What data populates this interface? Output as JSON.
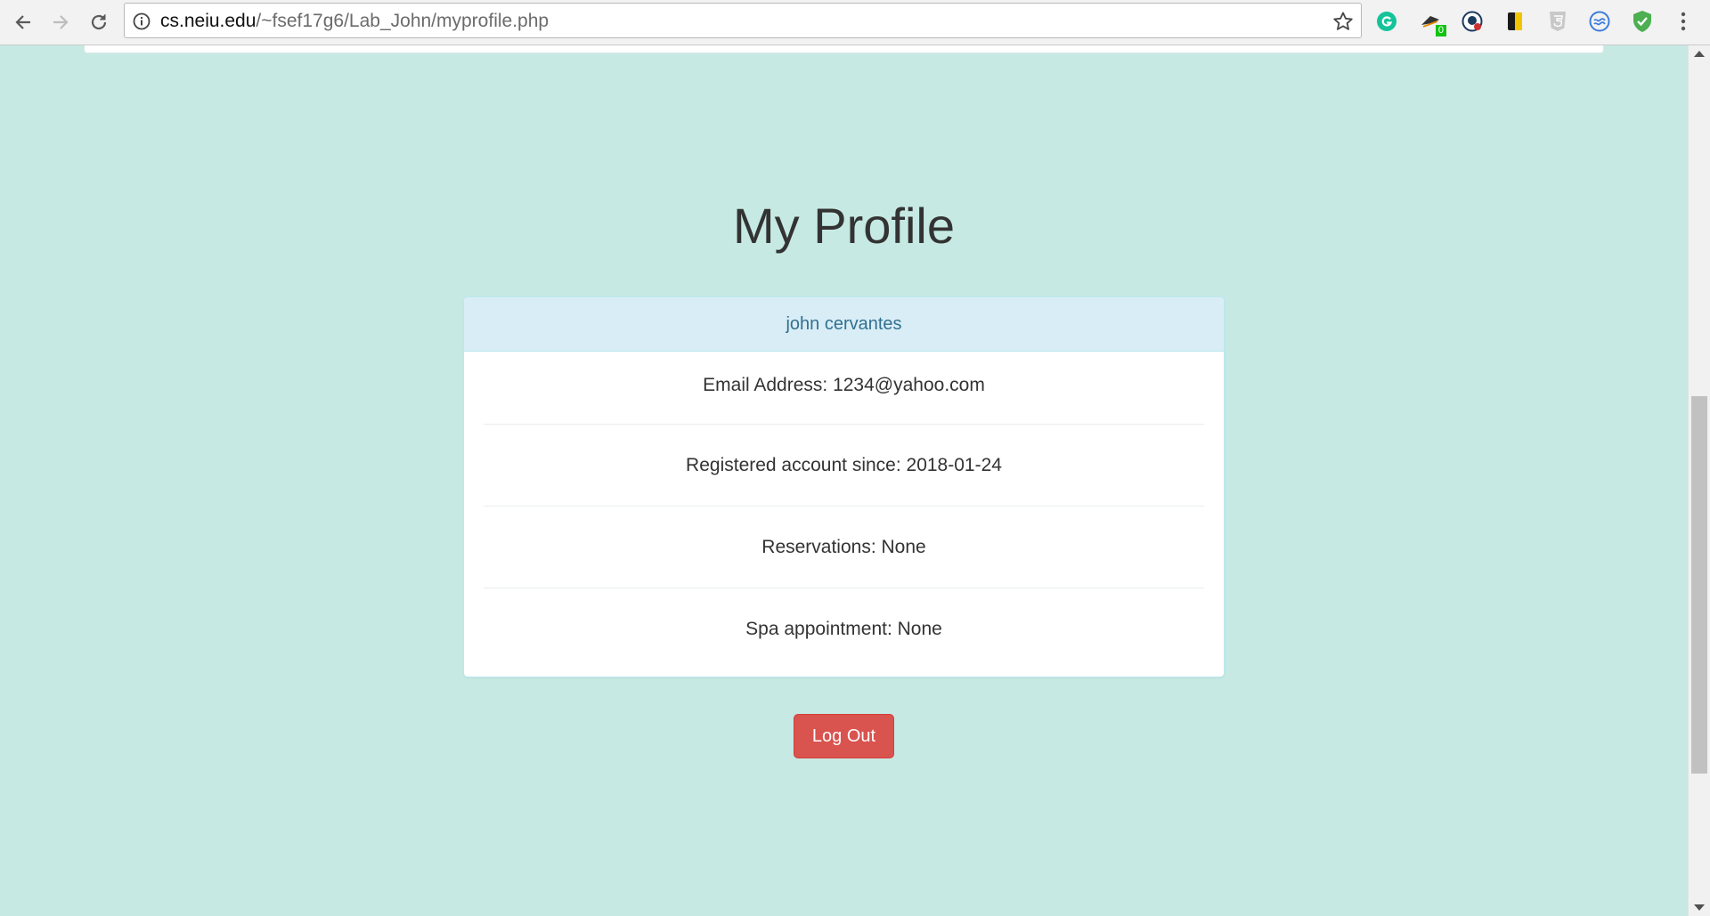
{
  "browser": {
    "url_host": "cs.neiu.edu",
    "url_path": "/~fsef17g6/Lab_John/myprofile.php",
    "extension_badge": "0"
  },
  "page": {
    "heading": "My Profile",
    "card": {
      "name": "john cervantes",
      "rows": [
        "Email Address: 1234@yahoo.com",
        "Registered account since: 2018-01-24",
        "Reservations: None",
        "Spa appointment: None"
      ]
    },
    "logout_label": "Log Out"
  },
  "colors": {
    "background": "#c6e9e3",
    "card_header_bg": "#d9edf7",
    "card_header_text": "#31708f",
    "logout_button": "#d9534f"
  }
}
